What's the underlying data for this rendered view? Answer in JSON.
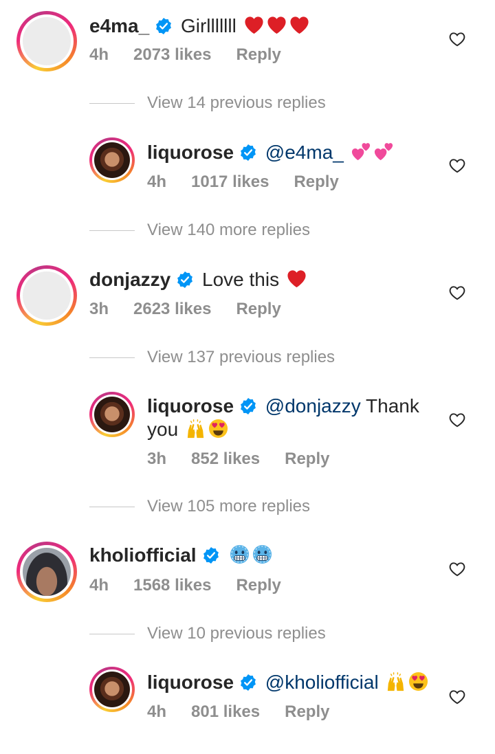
{
  "comments": [
    {
      "username": "e4ma_",
      "text": "Girlllllll",
      "emojis": [
        "red-heart",
        "red-heart",
        "red-heart"
      ],
      "time": "4h",
      "likes": "2073 likes",
      "reply": "Reply",
      "view_replies": "View 14 previous replies",
      "reply_item": {
        "username": "liquorose",
        "mention": "@e4ma_",
        "text": "",
        "emojis": [
          "two-hearts",
          "two-hearts"
        ],
        "time": "4h",
        "likes": "1017 likes",
        "reply": "Reply"
      },
      "more_replies": "View 140 more replies"
    },
    {
      "username": "donjazzy",
      "text": "Love this",
      "emojis": [
        "red-heart"
      ],
      "time": "3h",
      "likes": "2623 likes",
      "reply": "Reply",
      "view_replies": "View 137 previous replies",
      "reply_item": {
        "username": "liquorose",
        "mention": "@donjazzy",
        "text": "Thank",
        "text2": "you",
        "emojis": [
          "raising-hands",
          "heart-eyes"
        ],
        "time": "3h",
        "likes": "852 likes",
        "reply": "Reply"
      },
      "more_replies": "View 105 more replies"
    },
    {
      "username": "kholiofficial",
      "text": "",
      "emojis": [
        "cold-face",
        "cold-face"
      ],
      "time": "4h",
      "likes": "1568 likes",
      "reply": "Reply",
      "view_replies": "View 10 previous replies",
      "reply_item": {
        "username": "liquorose",
        "mention": "@kholiofficial",
        "text": "",
        "emojis": [
          "raising-hands",
          "heart-eyes"
        ],
        "time": "4h",
        "likes": "801 likes",
        "reply": "Reply"
      }
    }
  ],
  "colors": {
    "verified": "#0095f6",
    "mention": "#00376b",
    "meta": "#8e8e8e",
    "text": "#262626"
  },
  "icons": {
    "verified": "verified-badge-icon",
    "like": "heart-outline-icon"
  }
}
